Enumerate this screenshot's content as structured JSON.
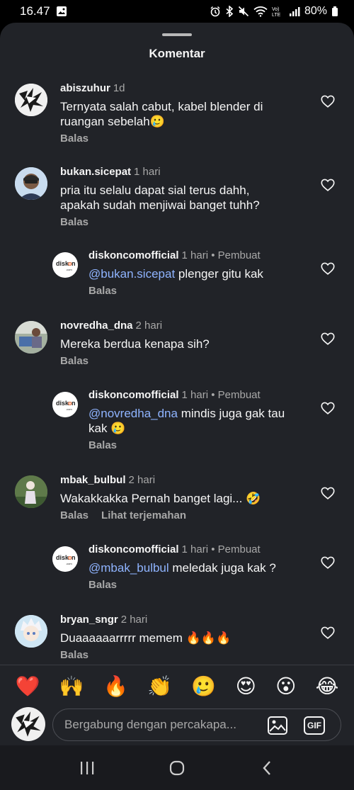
{
  "status": {
    "time": "16.47",
    "battery": "80%"
  },
  "sheet": {
    "title": "Komentar"
  },
  "comments": [
    {
      "username": "abiszuhur",
      "meta": "1d",
      "lines": [
        "Ternyata salah cabut, kabel blender di",
        "ruangan sebelah🥲"
      ],
      "actions": [
        "Balas"
      ]
    },
    {
      "username": "bukan.sicepat",
      "meta": "1 hari",
      "lines": [
        "pria itu selalu dapat sial terus dahh,",
        "apakah sudah menjiwai banget tuhh?"
      ],
      "actions": [
        "Balas"
      ]
    },
    {
      "username": "diskoncomofficial",
      "meta": "1 hari • Pembuat",
      "mention": "@bukan.sicepat",
      "lines": [
        " plenger gitu kak"
      ],
      "actions": [
        "Balas"
      ]
    },
    {
      "username": "novredha_dna",
      "meta": "2 hari",
      "lines": [
        "Mereka berdua kenapa sih?"
      ],
      "actions": [
        "Balas"
      ]
    },
    {
      "username": "diskoncomofficial",
      "meta": "1 hari • Pembuat",
      "mention": "@novredha_dna",
      "lines": [
        " mindis juga gak tau",
        "kak 🥲"
      ],
      "actions": [
        "Balas"
      ]
    },
    {
      "username": "mbak_bulbul",
      "meta": "2 hari",
      "lines": [
        "Wakakkakka Pernah banget lagi... 🤣"
      ],
      "actions": [
        "Balas",
        "Lihat terjemahan"
      ]
    },
    {
      "username": "diskoncomofficial",
      "meta": "1 hari • Pembuat",
      "mention": "@mbak_bulbul",
      "lines": [
        " meledak juga kak ?"
      ],
      "actions": [
        "Balas"
      ]
    },
    {
      "username": "bryan_sngr",
      "meta": "2 hari",
      "lines": [
        "Duaaaaaarrrrr memem 🔥🔥🔥"
      ],
      "actions": [
        "Balas"
      ]
    }
  ],
  "reactions": [
    "❤️",
    "🙌",
    "🔥",
    "👏",
    "🥲",
    "😍",
    "😮",
    "😂"
  ],
  "composer": {
    "placeholder": "Bergabung dengan percakapa...",
    "gif_label": "GIF"
  },
  "avatar_logo": {
    "text": "disk",
    "dot": "o",
    "text2": "n",
    "sub": ".com"
  }
}
